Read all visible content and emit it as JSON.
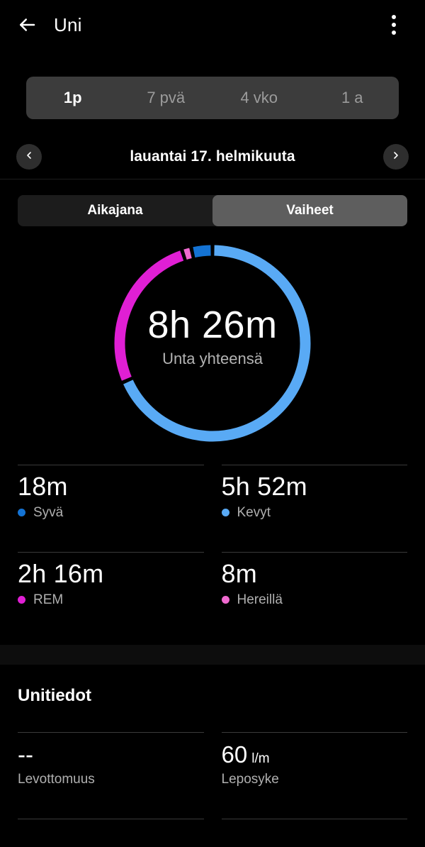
{
  "header": {
    "back_icon": "arrow-left-icon",
    "title": "Uni",
    "menu_icon": "overflow-menu-icon"
  },
  "range_tabs": {
    "items": [
      {
        "label": "1p",
        "active": true
      },
      {
        "label": "7 pvä",
        "active": false
      },
      {
        "label": "4 vko",
        "active": false
      },
      {
        "label": "1 a",
        "active": false
      }
    ]
  },
  "date_nav": {
    "prev_icon": "chevron-left-icon",
    "next_icon": "chevron-right-icon",
    "date": "lauantai 17. helmikuuta"
  },
  "view_toggle": {
    "items": [
      {
        "label": "Aikajana",
        "active": false
      },
      {
        "label": "Vaiheet",
        "active": true
      }
    ]
  },
  "colors": {
    "deep": "#1473d4",
    "light": "#59aaf5",
    "rem": "#e01fd4",
    "awake": "#f06ad0",
    "background": "#000000",
    "divider": "#3a3a3a",
    "muted_text": "#b0b0b0"
  },
  "chart_data": {
    "type": "pie",
    "title": "8h 26m",
    "subtitle": "Unta yhteensä",
    "center_value": "8h 26m",
    "center_label": "Unta yhteensä",
    "categories": [
      "Kevyt",
      "REM",
      "Hereillä",
      "Syvä"
    ],
    "values_minutes": [
      352,
      136,
      8,
      18
    ],
    "values_labels": [
      "5h 52m",
      "2h 16m",
      "8m",
      "18m"
    ],
    "colors": [
      "#59aaf5",
      "#e01fd4",
      "#f06ad0",
      "#1473d4"
    ],
    "total_minutes": 514,
    "legend": "inline-stat-cards"
  },
  "stats": [
    {
      "value": "18m",
      "label": "Syvä",
      "color": "#1473d4"
    },
    {
      "value": "5h 52m",
      "label": "Kevyt",
      "color": "#59aaf5"
    },
    {
      "value": "2h 16m",
      "label": "REM",
      "color": "#e01fd4"
    },
    {
      "value": "8m",
      "label": "Hereillä",
      "color": "#f06ad0"
    }
  ],
  "details_section": {
    "title": "Unitiedot",
    "items": [
      {
        "value": "--",
        "unit": "",
        "label": "Levottomuus"
      },
      {
        "value": "60",
        "unit": "l/m",
        "label": "Leposyke"
      }
    ]
  }
}
